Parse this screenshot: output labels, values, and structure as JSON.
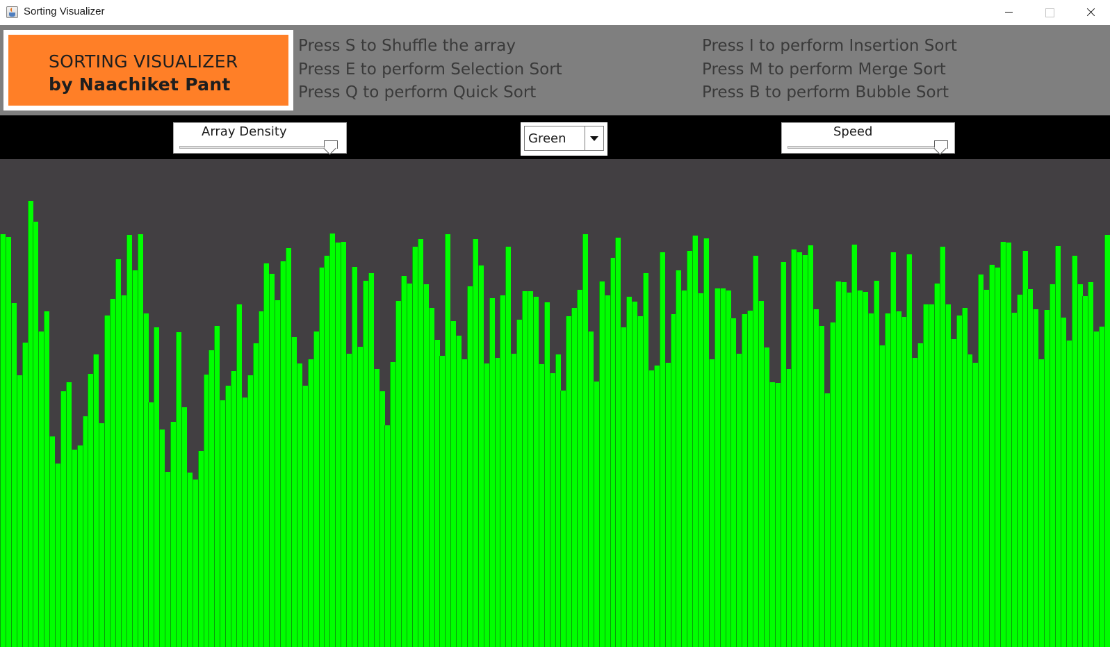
{
  "window": {
    "title": "Sorting Visualizer"
  },
  "logo": {
    "line1": "SORTING VISUALIZER",
    "line2": "by Naachiket Pant"
  },
  "instructions": {
    "shuffle": "Press S to Shuffle the array",
    "selection": "Press E to perform Selection Sort",
    "quick": "Press Q to perform Quick Sort",
    "insertion": "Press I to perform Insertion Sort",
    "merge": "Press M to perform Merge Sort",
    "bubble": "Press B to perform Bubble Sort"
  },
  "controls": {
    "density_label": "Array Density",
    "density_value": 0.97,
    "color_selected": "Green",
    "speed_label": "Speed",
    "speed_value": 0.98
  },
  "colors": {
    "bar": "#00ff00",
    "canvas": "#423f42",
    "header": "#7f7f7f",
    "logo": "#ff7f27"
  },
  "array_values": [
    592,
    588,
    494,
    390,
    437,
    640,
    610,
    453,
    482,
    302,
    263,
    367,
    380,
    283,
    289,
    331,
    392,
    420,
    321,
    476,
    500,
    556,
    505,
    591,
    540,
    592,
    479,
    351,
    459,
    312,
    251,
    323,
    452,
    344,
    250,
    240,
    281,
    391,
    426,
    461,
    354,
    375,
    396,
    492,
    358,
    390,
    436,
    482,
    550,
    535,
    498,
    553,
    572,
    445,
    407,
    375,
    413,
    453,
    544,
    561,
    593,
    580,
    581,
    421,
    545,
    431,
    526,
    536,
    399,
    367,
    318,
    409,
    497,
    532,
    522,
    574,
    585,
    521,
    487,
    441,
    418,
    592,
    468,
    447,
    413,
    518,
    585,
    547,
    407,
    501,
    415,
    505,
    574,
    421,
    470,
    511,
    511,
    503,
    406,
    495,
    393,
    420,
    368,
    475,
    487,
    513,
    592,
    453,
    381,
    525,
    505,
    558,
    587,
    459,
    503,
    496,
    475,
    536,
    397,
    404,
    566,
    408,
    478,
    540,
    512,
    568,
    590,
    508,
    586,
    413,
    515,
    515,
    512,
    472,
    421,
    478,
    483,
    561,
    497,
    430,
    380,
    379,
    552,
    399,
    570,
    566,
    562,
    576,
    485,
    461,
    364,
    466,
    525,
    524,
    509,
    577,
    512,
    510,
    479,
    526,
    433,
    479,
    566,
    482,
    474,
    563,
    415,
    436,
    492,
    492,
    522,
    574,
    492,
    442,
    476,
    487,
    420,
    408,
    534,
    513,
    548,
    544,
    581,
    580,
    480,
    506,
    568,
    514,
    485,
    413,
    484,
    521,
    575,
    473,
    440,
    561,
    521,
    504,
    524,
    453,
    460,
    591
  ]
}
